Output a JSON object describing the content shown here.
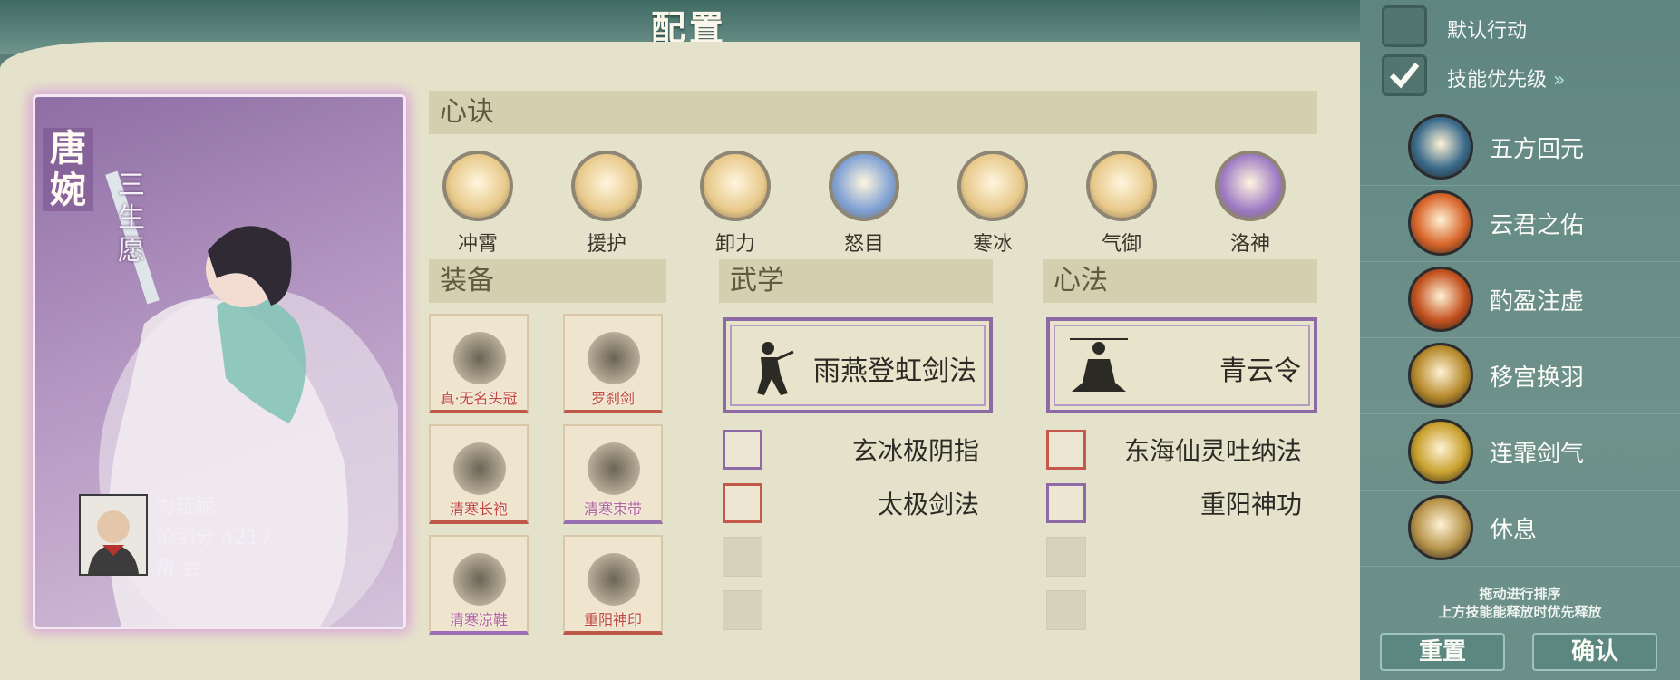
{
  "title": "配置",
  "character": {
    "name": "唐婉",
    "subtitle": "三生愿",
    "player_name": "为菈妮",
    "score_label": "论剑分",
    "score": "4217",
    "guild_label": "帮  会"
  },
  "sections": {
    "xinjue": "心诀",
    "equipment": "装备",
    "wuxue": "武学",
    "xinfa": "心法"
  },
  "xinjue_skills": [
    {
      "label": "冲霄",
      "color": "#e8c98a"
    },
    {
      "label": "援护",
      "color": "#e8c98a"
    },
    {
      "label": "卸力",
      "color": "#e8c98a"
    },
    {
      "label": "怒目",
      "color": "#7ea0d4"
    },
    {
      "label": "寒冰",
      "color": "#e8c98a"
    },
    {
      "label": "气御",
      "color": "#e8c98a"
    },
    {
      "label": "洛神",
      "color": "#9d7ac4"
    }
  ],
  "equipment": [
    {
      "label": "真·无名头冠",
      "rarity": "red"
    },
    {
      "label": "罗刹剑",
      "rarity": "red"
    },
    {
      "label": "清寒长袍",
      "rarity": "red"
    },
    {
      "label": "清寒束带",
      "rarity": "purple"
    },
    {
      "label": "清寒凉鞋",
      "rarity": "purple"
    },
    {
      "label": "重阳神印",
      "rarity": "red"
    }
  ],
  "wuxue": {
    "main": "雨燕登虹剑法",
    "list": [
      "玄冰极阴指",
      "太极剑法"
    ]
  },
  "xinfa": {
    "main": "青云令",
    "list": [
      "东海仙灵吐纳法",
      "重阳神功"
    ]
  },
  "right_panel": {
    "default_action": "默认行动",
    "skill_priority": "技能优先级",
    "skill_priority_arrow": "»",
    "skills": [
      {
        "name": "五方回元",
        "color": "#3c6c8c"
      },
      {
        "name": "云君之佑",
        "color": "#d9662b"
      },
      {
        "name": "酌盈注虚",
        "color": "#c4521f"
      },
      {
        "name": "移宫换羽",
        "color": "#b88b2d"
      },
      {
        "name": "连霏剑气",
        "color": "#c9a12e"
      },
      {
        "name": "休息",
        "color": "#b8944a"
      }
    ],
    "hint_line1": "拖动进行排序",
    "hint_line2": "上方技能能释放时优先释放",
    "reset_label": "重置",
    "confirm_label": "确认"
  }
}
